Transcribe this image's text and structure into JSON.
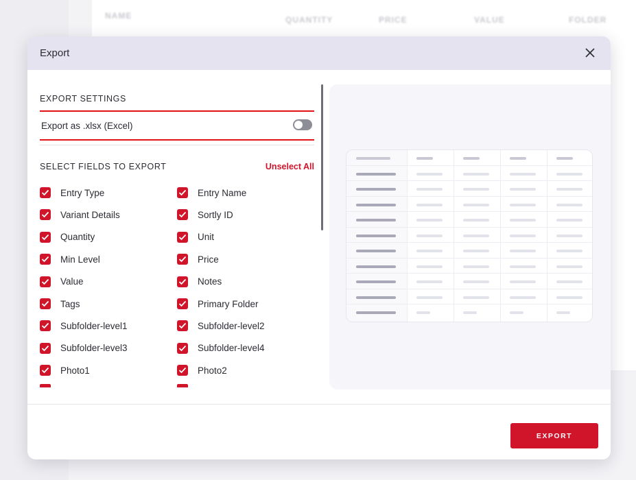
{
  "background": {
    "table_headers": [
      "NAME",
      "QUANTITY",
      "PRICE",
      "VALUE",
      "FOLDER"
    ]
  },
  "modal": {
    "title": "Export",
    "close_icon": "close-icon",
    "export_settings_label": "EXPORT SETTINGS",
    "xlsx_label": "Export as .xlsx (Excel)",
    "xlsx_enabled": false,
    "fields_label": "SELECT FIELDS TO EXPORT",
    "unselect_all_label": "Unselect All",
    "fields": [
      {
        "label": "Entry Type",
        "checked": true
      },
      {
        "label": "Entry Name",
        "checked": true
      },
      {
        "label": "Variant Details",
        "checked": true
      },
      {
        "label": "Sortly ID",
        "checked": true
      },
      {
        "label": "Quantity",
        "checked": true
      },
      {
        "label": "Unit",
        "checked": true
      },
      {
        "label": "Min Level",
        "checked": true
      },
      {
        "label": "Price",
        "checked": true
      },
      {
        "label": "Value",
        "checked": true
      },
      {
        "label": "Notes",
        "checked": true
      },
      {
        "label": "Tags",
        "checked": true
      },
      {
        "label": "Primary Folder",
        "checked": true
      },
      {
        "label": "Subfolder-level1",
        "checked": true
      },
      {
        "label": "Subfolder-level2",
        "checked": true
      },
      {
        "label": "Subfolder-level3",
        "checked": true
      },
      {
        "label": "Subfolder-level4",
        "checked": true
      },
      {
        "label": "Photo1",
        "checked": true
      },
      {
        "label": "Photo2",
        "checked": true
      }
    ],
    "export_button_label": "EXPORT"
  },
  "colors": {
    "accent": "#d0142a",
    "header_bg": "#e4e3ef",
    "highlight_border": "#e3101a"
  }
}
